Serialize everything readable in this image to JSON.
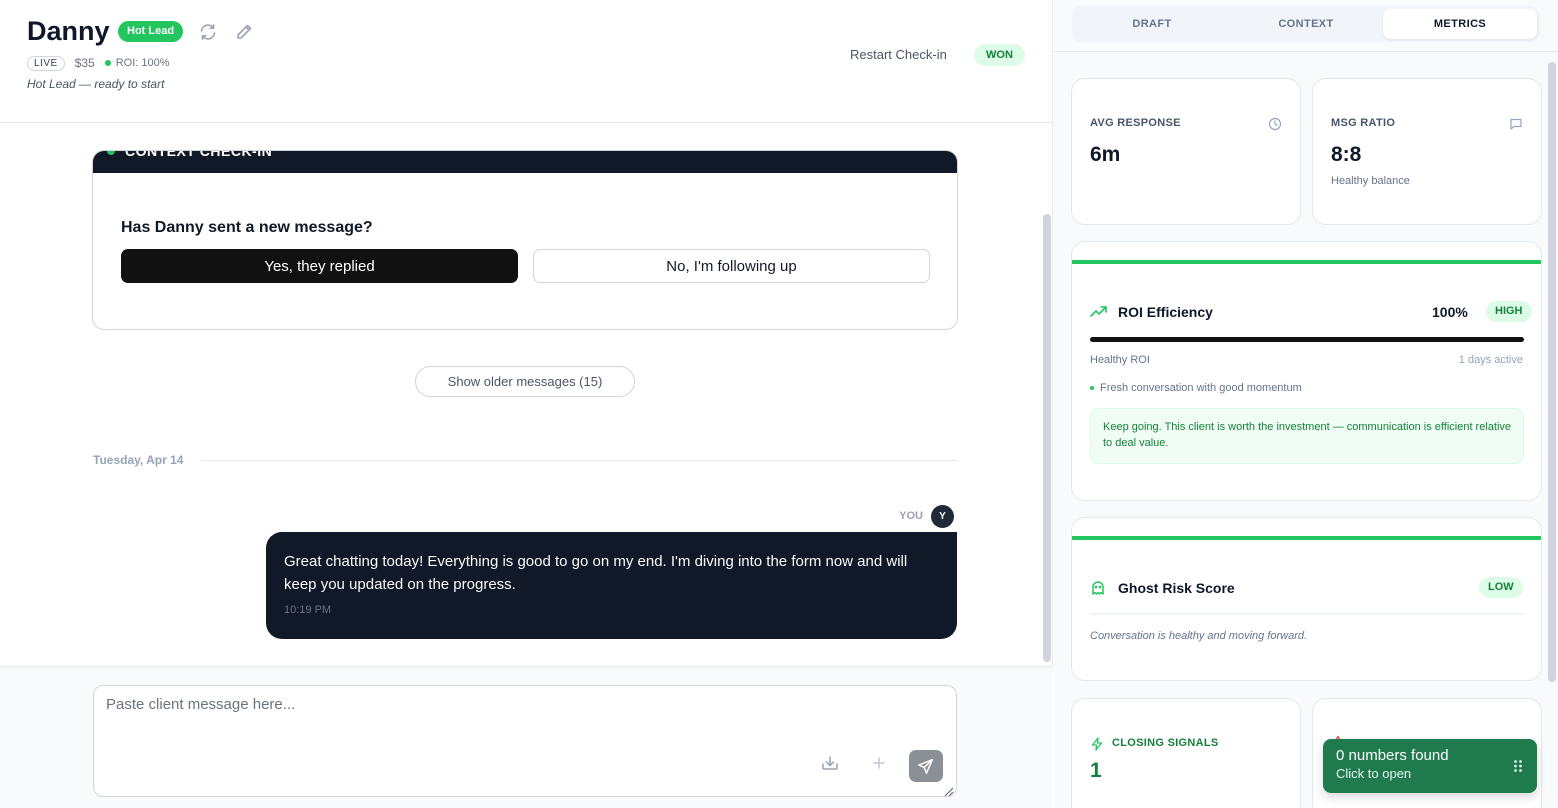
{
  "header": {
    "name": "Danny",
    "badge": "Hot Lead",
    "live": "LIVE",
    "amount": "$35",
    "roi": "ROI: 100%",
    "status_line": "Hot Lead — ready to start",
    "restart_label": "Restart Check-in",
    "stage": "WON"
  },
  "context_card": {
    "bar_label": "CONTEXT CHECK-IN",
    "question": "Has Danny sent a new message?",
    "yes_label": "Yes, they replied",
    "no_label": "No, I'm following up"
  },
  "chat": {
    "older_label": "Show older messages (15)",
    "date_label": "Tuesday, Apr 14",
    "sender_label": "YOU",
    "avatar_initial": "Y",
    "message_text": "Great chatting today! Everything is good to go on my end. I'm diving into the form now and will keep you updated on the progress.",
    "message_time": "10:19 PM"
  },
  "composer": {
    "placeholder": "Paste client message here...",
    "value": ""
  },
  "tabs": [
    {
      "label": "DRAFT",
      "active": false
    },
    {
      "label": "CONTEXT",
      "active": false
    },
    {
      "label": "METRICS",
      "active": true
    }
  ],
  "metrics": {
    "avg_response": {
      "label": "AVG RESPONSE",
      "value": "6m",
      "icon": "clock-icon"
    },
    "msg_ratio": {
      "label": "MSG RATIO",
      "value": "8:8",
      "sub": "Healthy balance",
      "icon": "message-icon"
    },
    "roi": {
      "title": "ROI Efficiency",
      "percent": "100%",
      "progress": 1.0,
      "badge": "HIGH",
      "health": "Healthy ROI",
      "days": "1 days active",
      "bullet": "Fresh conversation with good momentum",
      "tip": "Keep going. This client is worth the investment — communication is efficient relative to deal value."
    },
    "ghost": {
      "title": "Ghost Risk Score",
      "badge": "LOW",
      "desc": "Conversation is healthy and moving forward."
    },
    "closing": {
      "label": "CLOSING SIGNALS",
      "value": "1"
    }
  },
  "toast": {
    "title": "0 numbers found",
    "sub": "Click to open"
  },
  "colors": {
    "accent_green": "#22c55e",
    "dark": "#111827",
    "toast_bg": "#1f7a4d"
  }
}
